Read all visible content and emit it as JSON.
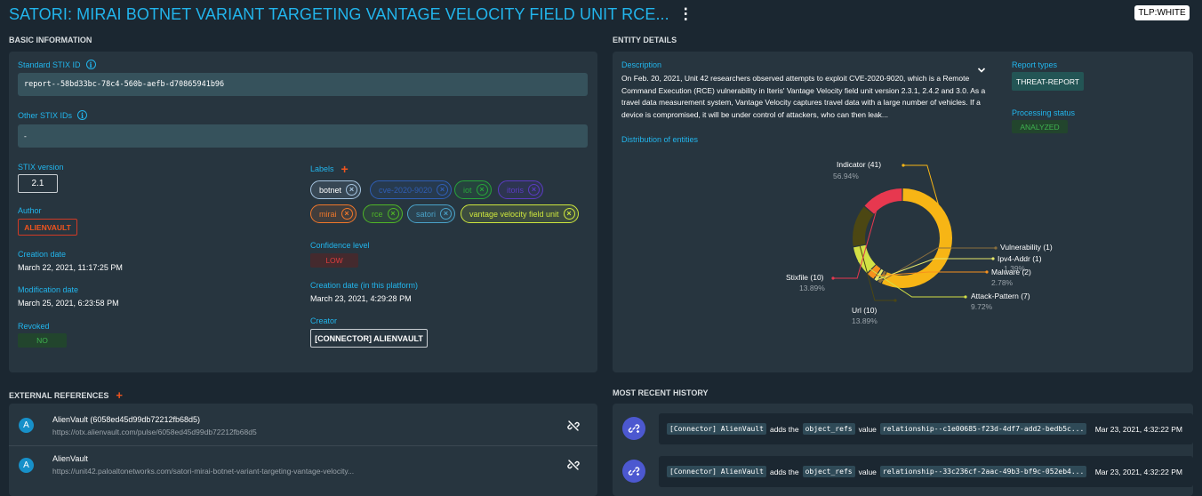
{
  "header": {
    "title": "SATORI: MIRAI BOTNET VARIANT TARGETING VANTAGE VELOCITY FIELD UNIT RCE...",
    "more_icon": "kebab-icon",
    "tlp": "TLP:WHITE"
  },
  "basic": {
    "section_title": "BASIC INFORMATION",
    "stix_id_label": "Standard STIX ID",
    "stix_id": "report--58bd33bc-78c4-560b-aefb-d70865941b96",
    "other_ids_label": "Other STIX IDs",
    "other_ids": "-",
    "stix_version_label": "STIX version",
    "stix_version": "2.1",
    "author_label": "Author",
    "author": "ALIENVAULT",
    "creation_label": "Creation date",
    "creation": "March 22, 2021, 11:17:25 PM",
    "modification_label": "Modification date",
    "modification": "March 25, 2021, 6:23:58 PM",
    "revoked_label": "Revoked",
    "revoked": "NO",
    "labels_label": "Labels",
    "labels": [
      {
        "text": "botnet",
        "color": "#a5c4e0"
      },
      {
        "text": "cve-2020-9020",
        "color": "#2f5eb5"
      },
      {
        "text": "iot",
        "color": "#27a53a"
      },
      {
        "text": "itoris",
        "color": "#5a3bc2"
      },
      {
        "text": "mirai",
        "color": "#f0772a"
      },
      {
        "text": "rce",
        "color": "#4fb527"
      },
      {
        "text": "satori",
        "color": "#4aa2c8"
      },
      {
        "text": "vantage velocity field unit",
        "color": "#cde63d"
      }
    ],
    "confidence_label": "Confidence level",
    "confidence": "LOW",
    "platform_date_label": "Creation date (in this platform)",
    "platform_date": "March 23, 2021, 4:29:28 PM",
    "creator_label": "Creator",
    "creator": "[CONNECTOR] ALIENVAULT"
  },
  "entity": {
    "section_title": "ENTITY DETAILS",
    "description_label": "Description",
    "description": "On Feb. 20, 2021, Unit 42 researchers observed attempts to exploit CVE-2020-9020, which is a Remote Command Execution (RCE) vulnerability in Iteris' Vantage Velocity field unit version 2.3.1, 2.4.2 and 3.0. As a travel data measurement system, Vantage Velocity captures travel data with a large number of vehicles. If a device is compromised, it will be under control of attackers, who can then leak...",
    "report_types_label": "Report types",
    "report_type": "THREAT-REPORT",
    "processing_label": "Processing status",
    "processing": "ANALYZED",
    "distribution_label": "Distribution of entities"
  },
  "chart_data": {
    "type": "pie",
    "title": "Distribution of entities",
    "slices": [
      {
        "label": "Indicator (41)",
        "value": 41,
        "percent": "56.94%",
        "color": "#f7b515"
      },
      {
        "label": "Vulnerability (1)",
        "value": 1,
        "percent": "",
        "color": "#8b6f3e"
      },
      {
        "label": "Ipv4-Addr (1)",
        "value": 1,
        "percent": "1.39%",
        "color": "#e7e86a"
      },
      {
        "label": "Malware (2)",
        "value": 2,
        "percent": "2.78%",
        "color": "#f7911d"
      },
      {
        "label": "Attack-Pattern (7)",
        "value": 7,
        "percent": "9.72%",
        "color": "#d3e045"
      },
      {
        "label": "Url (10)",
        "value": 10,
        "percent": "13.89%",
        "color": "#4c4713"
      },
      {
        "label": "Stixfile (10)",
        "value": 10,
        "percent": "13.89%",
        "color": "#e7384f"
      }
    ]
  },
  "external": {
    "section_title": "EXTERNAL REFERENCES",
    "items": [
      {
        "avatar": "A",
        "title": "AlienVault (6058ed45d99db72212fb68d5)",
        "url": "https://otx.alienvault.com/pulse/6058ed45d99db72212fb68d5"
      },
      {
        "avatar": "A",
        "title": "AlienVault",
        "url": "https://unit42.paloaltonetworks.com/satori-mirai-botnet-variant-targeting-vantage-velocity..."
      }
    ]
  },
  "history": {
    "section_title": "MOST RECENT HISTORY",
    "items": [
      {
        "actor": "[Connector] AlienVault",
        "adds": "adds the",
        "field": "object_refs",
        "value_word": "value",
        "value": "relationship--c1e00685-f23d-4df7-add2-bedb5c...",
        "date": "Mar 23, 2021, 4:32:22 PM"
      },
      {
        "actor": "[Connector] AlienVault",
        "adds": "adds the",
        "field": "object_refs",
        "value_word": "value",
        "value": "relationship--33c236cf-2aac-49b3-bf9c-052eb4...",
        "date": "Mar 23, 2021, 4:32:22 PM"
      }
    ]
  }
}
